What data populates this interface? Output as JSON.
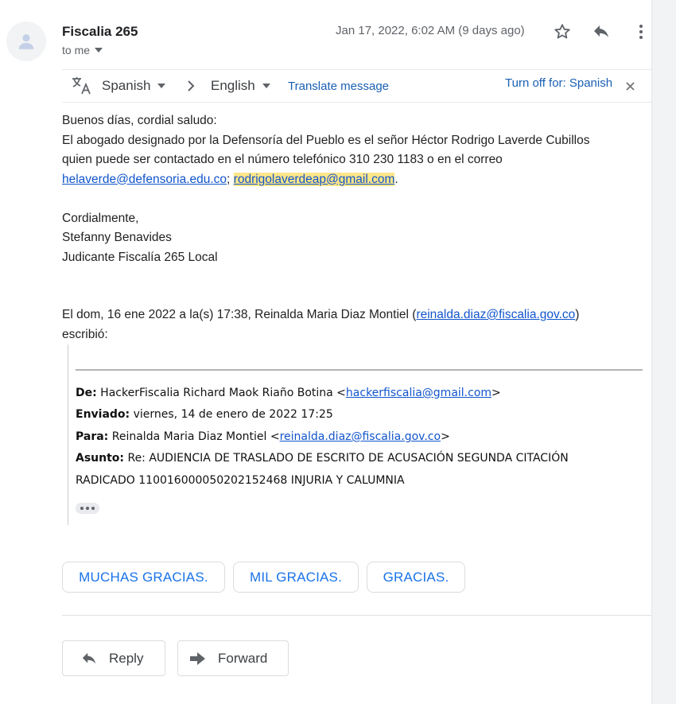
{
  "header": {
    "sender": "Fiscalia 265",
    "recipient": "to me",
    "date": "Jan 17, 2022, 6:02 AM (9 days ago)",
    "icons": [
      "star-icon",
      "reply-icon",
      "more-vert-icon"
    ]
  },
  "translate_bar": {
    "source_language": "Spanish",
    "target_language": "English",
    "translate_link": "Translate message",
    "turn_off": "Turn off for: Spanish"
  },
  "body": {
    "greeting": "Buenos días, cordial saludo:",
    "line1": "El abogado designado por la Defensoría del Pueblo es el señor Héctor Rodrigo Laverde Cubillos",
    "line2": "quien puede ser contactado en el número telefónico 310 230 1183 o en el correo",
    "email1": "helaverde@defensoria.edu.co",
    "sep": ";",
    "email2": "rodrigolaverdeap@gmail.com",
    "end": ".",
    "closing": "Cordialmente,",
    "signature_name": "Stefanny Benavides",
    "signature_title": "Judicante Fiscalía 265 Local"
  },
  "reply_header": {
    "prefix": "El dom, 16 ene 2022 a la(s) 17:38, Reinalda Maria Diaz Montiel (",
    "email": "reinalda.diaz@fiscalia.gov.co",
    "suffix": ")",
    "wrote": "escribió:"
  },
  "quoted": {
    "from_label": "De:",
    "from_name": "HackerFiscalia Richard Maok Riaño Botina <",
    "from_email": "hackerfiscalia@gmail.com",
    "from_close": ">",
    "sent_label": "Enviado:",
    "sent_value": "viernes, 14 de enero de 2022 17:25",
    "to_label": "Para:",
    "to_name": "Reinalda Maria Diaz Montiel <",
    "to_email": "reinalda.diaz@fiscalia.gov.co",
    "to_close": ">",
    "subject_label": "Asunto:",
    "subject_line1": "Re: AUDIENCIA DE TRASLADO DE ESCRITO DE ACUSACIÓN SEGUNDA CITACIÓN",
    "subject_line2": "RADICADO 110016000050202152468 INJURIA Y CALUMNIA"
  },
  "smart_replies": [
    "MUCHAS GRACIAS.",
    "MIL GRACIAS.",
    "GRACIAS."
  ],
  "actions": {
    "reply": "Reply",
    "forward": "Forward"
  },
  "colors": {
    "link": "#1155cc",
    "chip_text": "#1a73e8",
    "highlight": "#fde68a"
  }
}
